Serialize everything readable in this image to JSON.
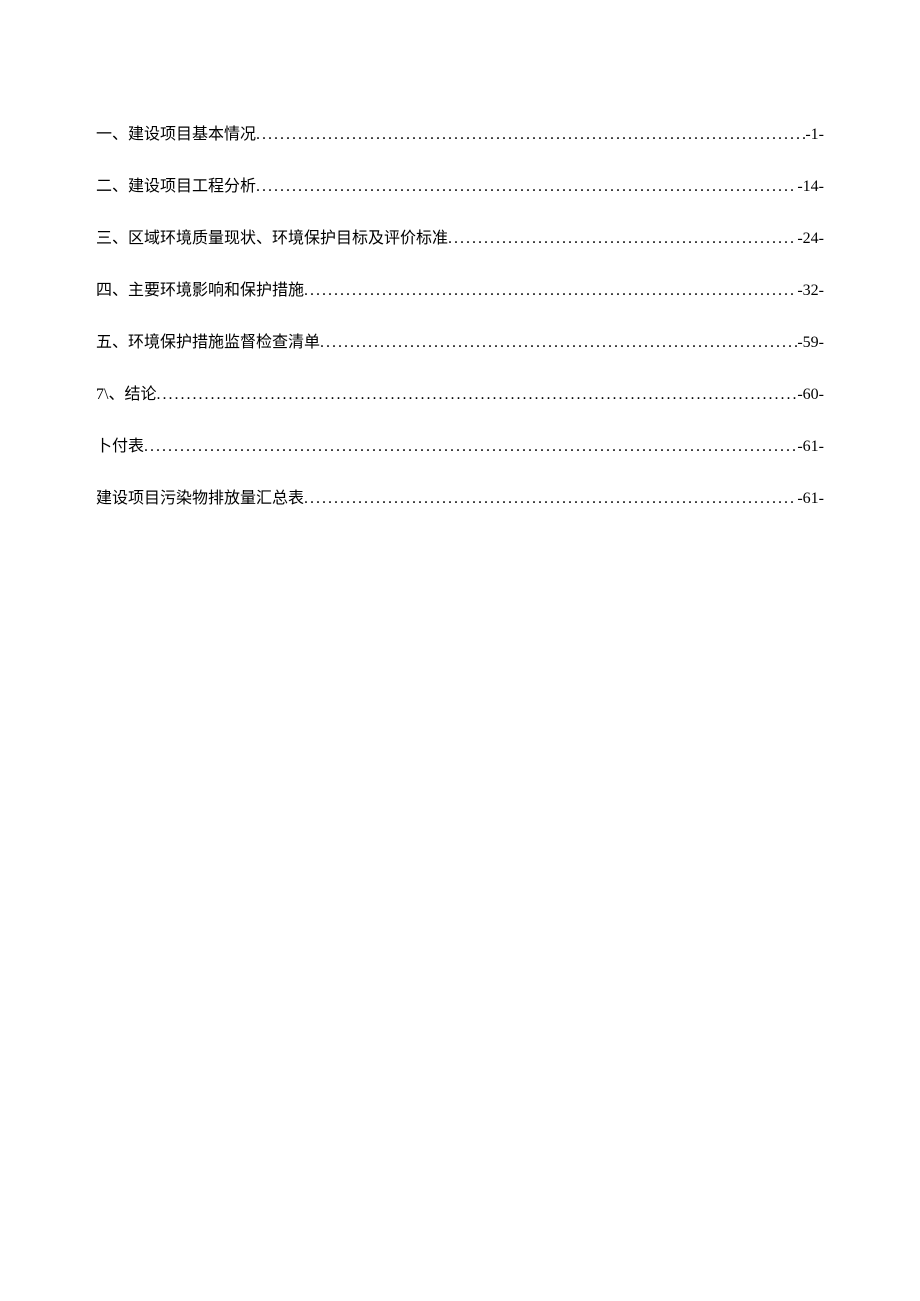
{
  "toc": {
    "entries": [
      {
        "title": "一、建设项目基本情况",
        "page": "-1-"
      },
      {
        "title": "二、建设项目工程分析",
        "page": "-14-"
      },
      {
        "title": "三、区域环境质量现状、环境保护目标及评价标准",
        "page": "-24-"
      },
      {
        "title": "四、主要环境影响和保护措施",
        "page": "-32-"
      },
      {
        "title": "五、环境保护措施监督检查清单",
        "page": "-59-"
      },
      {
        "title": "7\\、结论",
        "page": "-60-"
      },
      {
        "title": "卜付表",
        "page": "-61-"
      },
      {
        "title": "建设项目污染物排放量汇总表",
        "page": "-61-"
      }
    ]
  }
}
